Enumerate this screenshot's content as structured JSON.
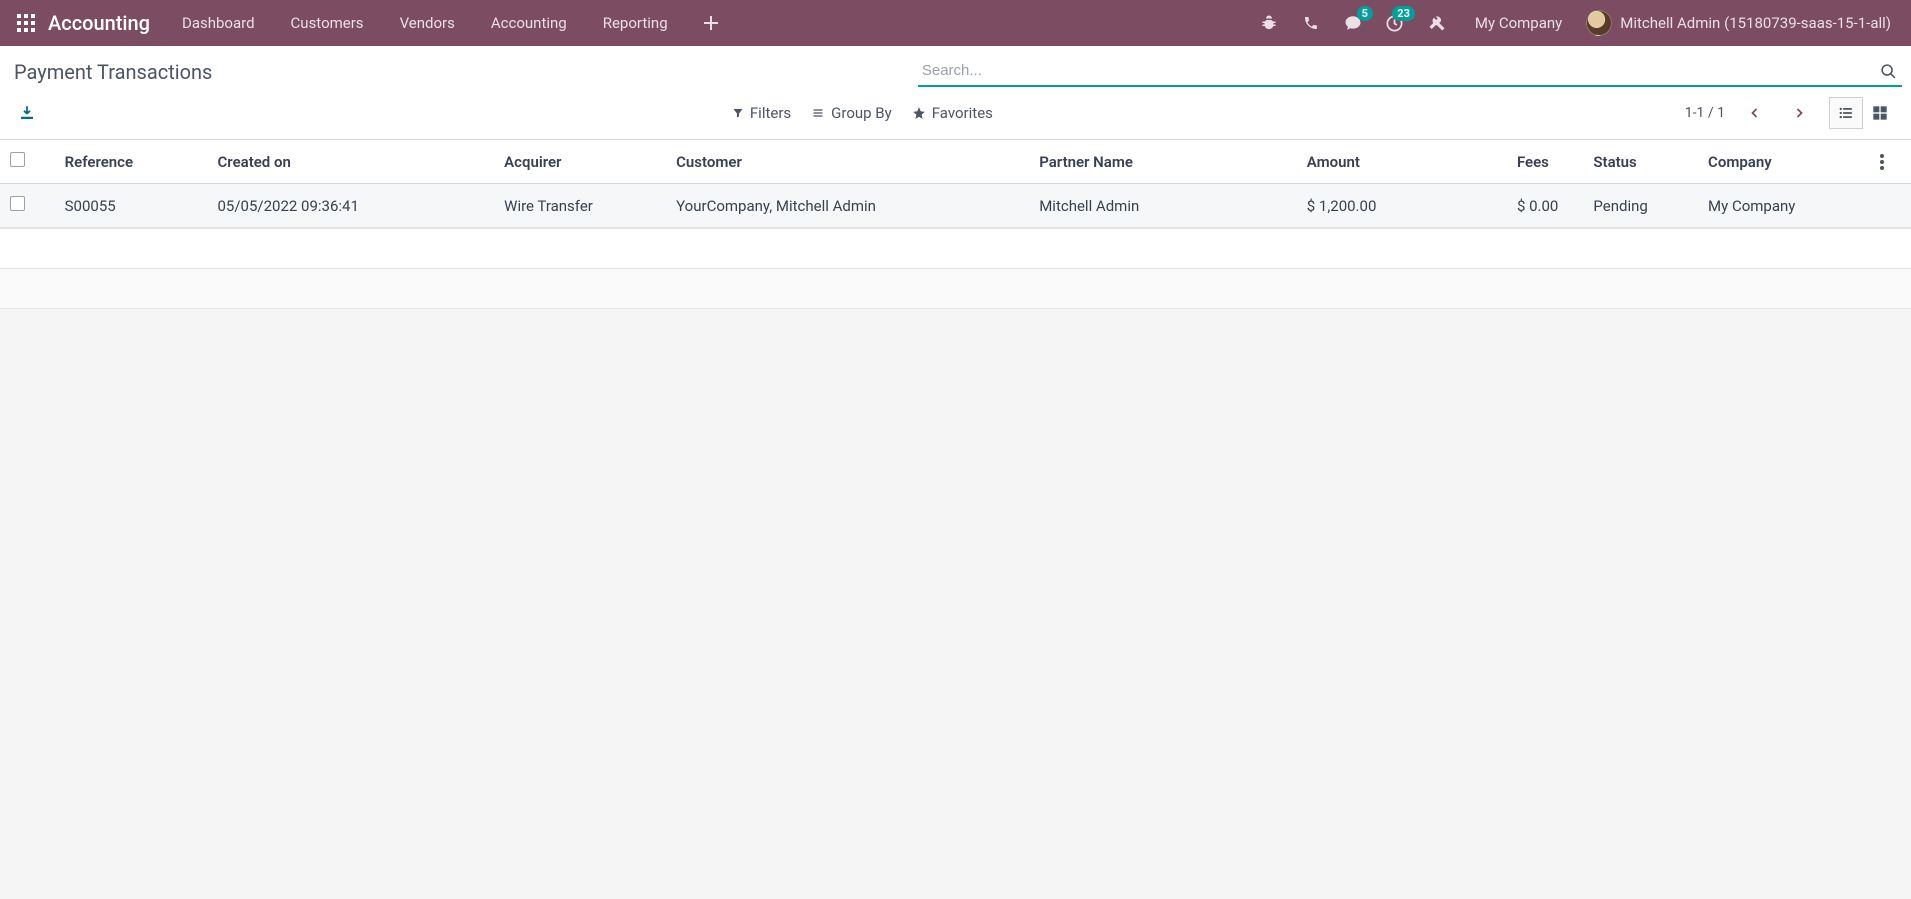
{
  "navbar": {
    "app_name": "Accounting",
    "menu": [
      "Dashboard",
      "Customers",
      "Vendors",
      "Accounting",
      "Reporting"
    ],
    "messages_badge": "5",
    "activities_badge": "23",
    "company": "My Company",
    "user": "Mitchell Admin (15180739-saas-15-1-all)"
  },
  "control_panel": {
    "breadcrumb": "Payment Transactions",
    "search_placeholder": "Search...",
    "filters_label": "Filters",
    "groupby_label": "Group By",
    "favorites_label": "Favorites",
    "pager": "1-1 / 1"
  },
  "table": {
    "headers": {
      "reference": "Reference",
      "created_on": "Created on",
      "acquirer": "Acquirer",
      "customer": "Customer",
      "partner_name": "Partner Name",
      "amount": "Amount",
      "fees": "Fees",
      "status": "Status",
      "company": "Company"
    },
    "rows": [
      {
        "reference": "S00055",
        "created_on": "05/05/2022 09:36:41",
        "acquirer": "Wire Transfer",
        "customer": "YourCompany, Mitchell Admin",
        "partner_name": "Mitchell Admin",
        "amount": "$ 1,200.00",
        "fees": "$ 0.00",
        "status": "Pending",
        "company": "My Company"
      }
    ]
  }
}
